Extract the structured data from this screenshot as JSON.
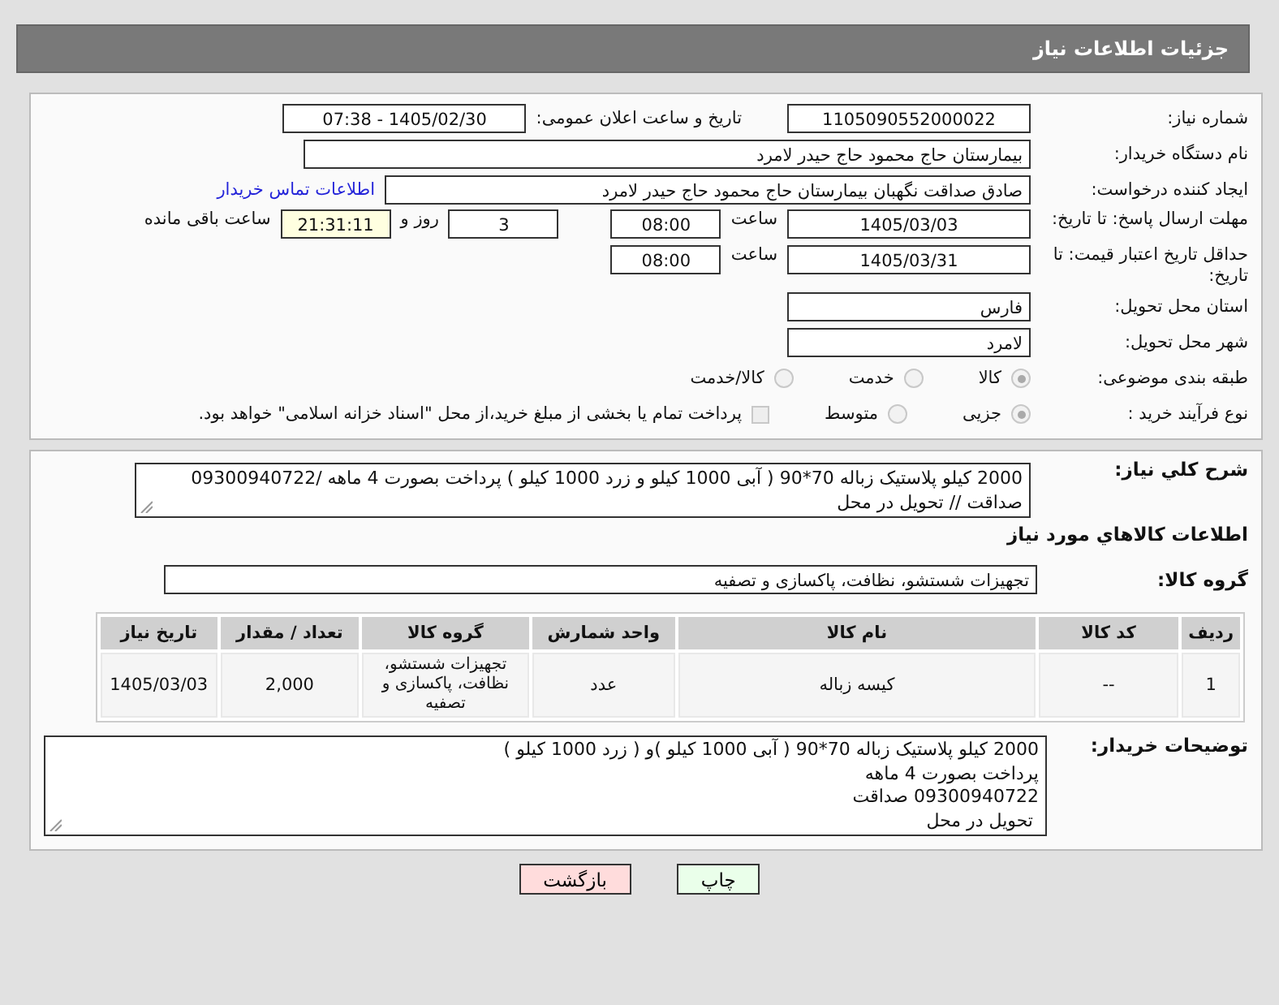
{
  "header": {
    "title": "جزئیات اطلاعات نیاز"
  },
  "details": {
    "need_number": {
      "label": "شماره نیاز:",
      "value": "1105090552000022"
    },
    "announce": {
      "label": "تاریخ و ساعت اعلان عمومی:",
      "value": "1405/02/30 - 07:38"
    },
    "buyer_org": {
      "label": "نام دستگاه خریدار:",
      "value": "بیمارستان حاج محمود حاج حیدر لامرد"
    },
    "requester": {
      "label": "ایجاد کننده درخواست:",
      "value": "صادق صداقت نگهبان بیمارستان حاج محمود حاج حیدر لامرد",
      "link": "اطلاعات تماس خریدار"
    },
    "deadline": {
      "label": "مهلت ارسال پاسخ: تا تاریخ:",
      "date": "1405/03/03",
      "time_label": "ساعت",
      "time": "08:00",
      "days": "3",
      "days_label": "روز و",
      "remaining": "21:31:11",
      "remaining_label": "ساعت باقی مانده"
    },
    "validity": {
      "label": "حداقل تاریخ اعتبار قیمت: تا تاریخ:",
      "date": "1405/03/31",
      "time_label": "ساعت",
      "time": "08:00"
    },
    "province": {
      "label": "استان محل تحویل:",
      "value": "فارس"
    },
    "city": {
      "label": "شهر محل تحویل:",
      "value": "لامرد"
    },
    "category": {
      "label": "طبقه بندی موضوعی:",
      "options": [
        {
          "label": "کالا",
          "selected": true
        },
        {
          "label": "خدمت",
          "selected": false
        },
        {
          "label": "کالا/خدمت",
          "selected": false
        }
      ]
    },
    "process": {
      "label": "نوع فرآیند خرید :",
      "options": [
        {
          "label": "جزیی",
          "selected": true
        },
        {
          "label": "متوسط",
          "selected": false
        }
      ],
      "payment": {
        "checked": false,
        "text": "پرداخت تمام یا بخشی از مبلغ خرید،از محل \"اسناد خزانه اسلامی\" خواهد بود."
      }
    }
  },
  "description": {
    "label": "شرح کلي نياز:",
    "text": "2000 کیلو پلاستیک زباله 70*90 ( آبی 1000 کیلو و زرد 1000 کیلو ) پرداخت بصورت 4 ماهه /09300940722 صداقت // تحویل در محل"
  },
  "goods": {
    "title": "اطلاعات کالاهاي مورد نياز",
    "group_label": "گروه کالا:",
    "group_value": "تجهیزات شستشو، نظافت، پاکسازی و تصفیه",
    "columns": [
      "ردیف",
      "کد کالا",
      "نام کالا",
      "واحد شمارش",
      "گروه کالا",
      "تعداد / مقدار",
      "تاریخ نیاز"
    ],
    "rows": [
      [
        "1",
        "--",
        "کیسه زباله",
        "عدد",
        "تجهیزات شستشو، نظافت، پاکسازی و تصفیه",
        "2,000",
        "1405/03/03"
      ]
    ]
  },
  "buyer_notes": {
    "label": "توضیحات خریدار:",
    "lines": [
      "2000 کیلو پلاستیک زباله 70*90 ( آبی 1000 کیلو )و ( زرد 1000 کیلو )",
      "پرداخت بصورت 4 ماهه",
      "09300940722 صداقت",
      " تحویل در محل"
    ]
  },
  "buttons": [
    {
      "kind": "print",
      "label": "چاپ"
    },
    {
      "kind": "back",
      "label": "بازگشت"
    }
  ]
}
